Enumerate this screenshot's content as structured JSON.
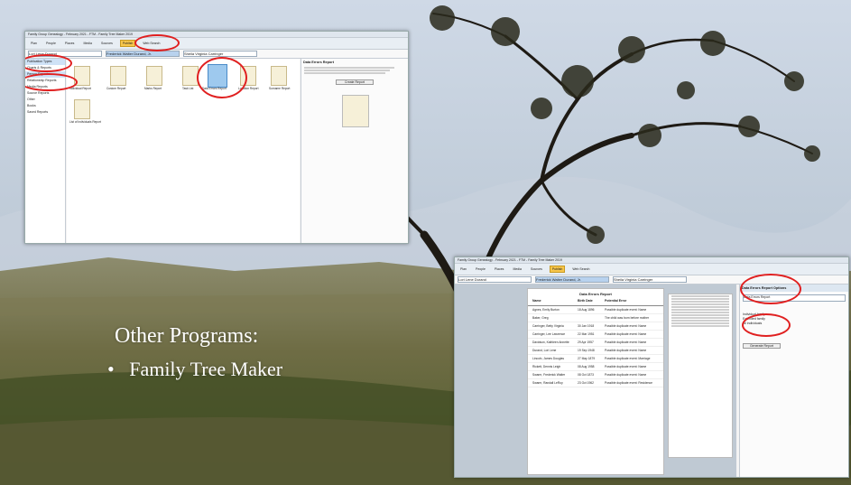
{
  "slide": {
    "title": "Other Programs:",
    "bullet_marker": "•",
    "bullet": "Family Tree Maker"
  },
  "shot1": {
    "window_title": "Family Group Genealogy - February 2021 - FTM - Family Tree Maker 2019",
    "tabs": [
      "Plan",
      "People",
      "Places",
      "Media",
      "Sources",
      "Publish",
      "Web Search"
    ],
    "active_tab": "Publish",
    "nav_person": "Lori Lene Durand",
    "nav_person2": "Frederick Walter Durand, Jr.",
    "nav_person3": "Sheila Virginia Carringer",
    "sidebar": [
      "Publication Types",
      "Charts & Reports",
      "Person Reports",
      "Relationship Reports",
      "Media Reports",
      "Source Reports",
      "Other",
      "Books",
      "Saved Reports"
    ],
    "reports": [
      "Individual Report",
      "Custom Report",
      "Marks Report",
      "Task List",
      "Data Errors Report",
      "Location Report",
      "Surname Report",
      "List of Individuals Report"
    ],
    "detail_title": "Data Errors Report",
    "detail_button": "Create Report"
  },
  "shot2": {
    "panel_title": "Data Errors Report Options",
    "report_title": "Data Errors Report",
    "table_headers": [
      "Name",
      "Birth Date",
      "Potential Error"
    ],
    "rows": [
      [
        "Agnes, Emily Burton",
        "18 Aug 1896",
        "Possible duplicate event: Name"
      ],
      [
        "Baker, Greg",
        "",
        "The child was born before mother"
      ],
      [
        "Carringer, Betty Virginia",
        "30 Jan 1918",
        "Possible duplicate event: Name"
      ],
      [
        "Carringer, Lee Lawrence",
        "22 Mar 1951",
        "Possible duplicate event: Name"
      ],
      [
        "Davidson, Kathleen Annette",
        "29 Apr 1957",
        "Possible duplicate event: Name"
      ],
      [
        "Durand, Lori Lene",
        "19 Sep 1948",
        "Possible duplicate event: Name"
      ],
      [
        "Lincoln, James Douglas",
        "27 May 1879",
        "Possible duplicate event: Marriage"
      ],
      [
        "Rickett, Dennis Leigh",
        "08 Aug 1958",
        "Possible duplicate event: Name"
      ],
      [
        "Swarm, Frederick Walter",
        "08 Oct 1873",
        "Possible duplicate event: Name"
      ],
      [
        "Swarm, Randall LeRoy",
        "23 Oct 1962",
        "Possible duplicate event: Residence"
      ]
    ],
    "options": [
      "Individual family",
      "Extended family",
      "All individuals"
    ],
    "generate_button": "Generate Report"
  }
}
